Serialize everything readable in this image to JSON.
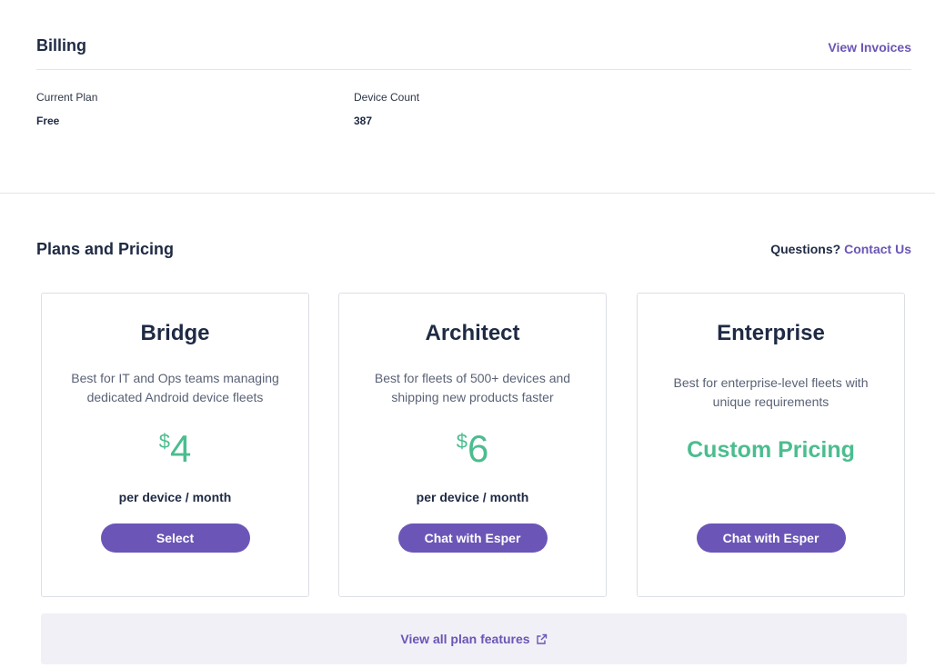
{
  "billing": {
    "title": "Billing",
    "view_invoices": "View Invoices",
    "current_plan_label": "Current Plan",
    "current_plan_value": "Free",
    "device_count_label": "Device Count",
    "device_count_value": "387"
  },
  "plans": {
    "title": "Plans and Pricing",
    "questions": "Questions?",
    "contact_us": "Contact Us",
    "items": [
      {
        "name": "Bridge",
        "description": "Best for IT and Ops teams managing dedicated Android device fleets",
        "currency": "$",
        "price": "4",
        "period": "per device / month",
        "button": "Select"
      },
      {
        "name": "Architect",
        "description": "Best for fleets of 500+ devices and shipping new products faster",
        "currency": "$",
        "price": "6",
        "period": "per device / month",
        "button": "Chat with Esper"
      },
      {
        "name": "Enterprise",
        "description": "Best for enterprise-level fleets with unique requirements",
        "custom_price": "Custom Pricing",
        "button": "Chat with Esper"
      }
    ],
    "view_all_features": "View all plan features"
  },
  "colors": {
    "accent": "#6b56b7",
    "price_green": "#4bbd8f",
    "text_dark": "#1f2a44"
  },
  "icons": {
    "external_link": "external-link-icon"
  }
}
